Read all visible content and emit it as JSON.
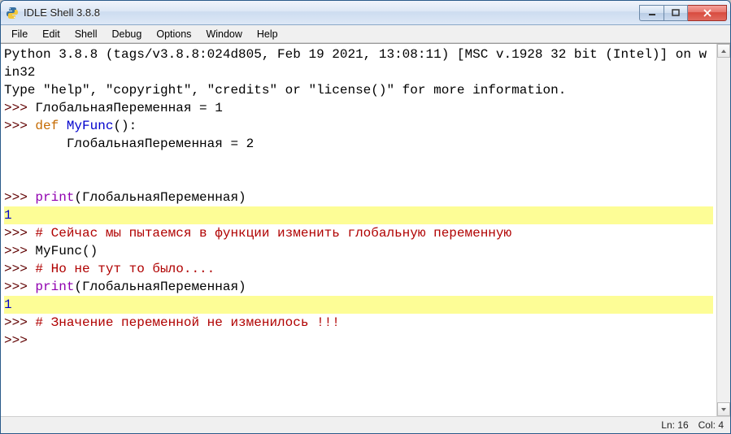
{
  "window": {
    "title": "IDLE Shell 3.8.8"
  },
  "menu": {
    "items": [
      "File",
      "Edit",
      "Shell",
      "Debug",
      "Options",
      "Window",
      "Help"
    ]
  },
  "shell": {
    "banner1": "Python 3.8.8 (tags/v3.8.8:024d805, Feb 19 2021, 13:08:11) [MSC v.1928 32 bit (Intel)] on win32",
    "banner2": "Type \"help\", \"copyright\", \"credits\" or \"license()\" for more information.",
    "prompt": ">>> ",
    "lines": {
      "l1": "ГлобальнаяПеременная = 1",
      "l2_kw": "def",
      "l2_name": " MyFunc",
      "l2_rest": "():",
      "l3": "        ГлобальнаяПеременная = 2",
      "l4_builtin": "print",
      "l4_rest": "(ГлобальнаяПеременная)",
      "out1": "1",
      "l5_comment": "# Сейчас мы пытаемся в функции изменить глобальную переменную",
      "l6": "MyFunc()",
      "l7_comment": "# Но не тут то было....",
      "l8_builtin": "print",
      "l8_rest": "(ГлобальнаяПеременная)",
      "out2": "1",
      "l9_comment": "# Значение переменной не изменилось !!!"
    }
  },
  "status": {
    "ln": "Ln: 16",
    "col": "Col: 4"
  }
}
